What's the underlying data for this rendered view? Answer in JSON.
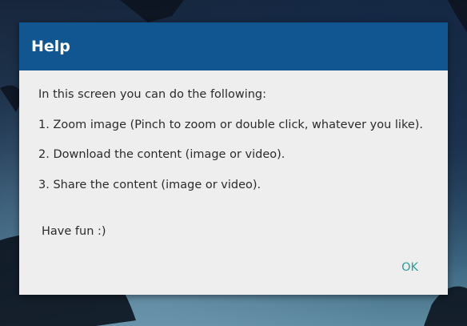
{
  "dialog": {
    "title": "Help",
    "intro": "In this screen you can do the following:",
    "items": [
      "1. Zoom image (Pinch to zoom or double click, whatever you like).",
      "2. Download the content (image or video).",
      "3. Share the content (image or video)."
    ],
    "closing": "Have fun :)",
    "ok_label": "OK"
  },
  "colors": {
    "header": "#115591",
    "body": "#eeeeee",
    "accent": "#2a9d9f"
  }
}
